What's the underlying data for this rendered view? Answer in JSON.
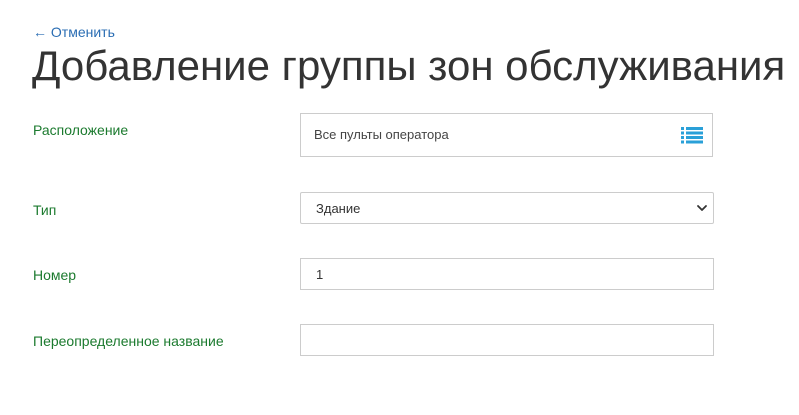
{
  "header": {
    "cancel_label": "← Отменить",
    "title": "Добавление группы зон обслуживания"
  },
  "form": {
    "location": {
      "label": "Расположение",
      "value": "Все пульты оператора",
      "icon": "list-icon"
    },
    "type": {
      "label": "Тип",
      "value": "Здание",
      "icon": "chevron-down-icon"
    },
    "number": {
      "label": "Номер",
      "value": "1"
    },
    "override_name": {
      "label": "Переопределенное название",
      "value": ""
    }
  },
  "colors": {
    "link": "#2a6db3",
    "label": "#1b7a2e",
    "title": "#333333",
    "icon": "#2aa0d8",
    "border": "#cccccc"
  }
}
